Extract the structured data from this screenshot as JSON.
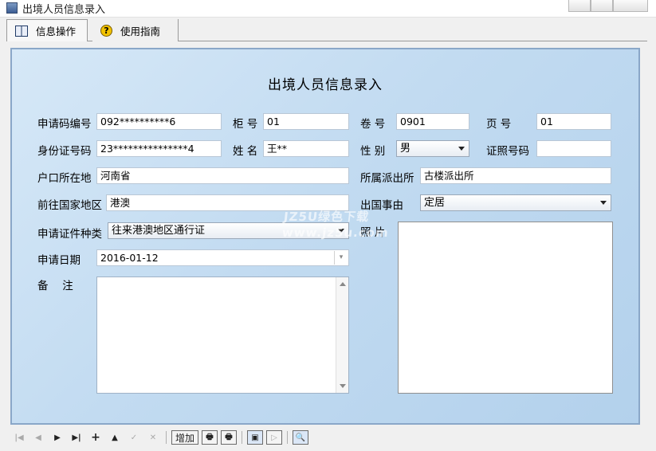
{
  "window": {
    "title": "出境人员信息录入"
  },
  "tabs": [
    {
      "label": "信息操作",
      "icon": "book-icon"
    },
    {
      "label": "使用指南",
      "icon": "help-icon"
    }
  ],
  "form": {
    "title": "出境人员信息录入",
    "apply_no": {
      "label": "申请码编号",
      "value": "092**********6"
    },
    "cabinet_no": {
      "label": "柜 号",
      "value": "01"
    },
    "volume_no": {
      "label": "卷 号",
      "value": "0901"
    },
    "page_no": {
      "label": "页 号",
      "value": "01"
    },
    "id_no": {
      "label": "身份证号码",
      "value": "23***************4"
    },
    "name": {
      "label": "姓 名",
      "value": "王**"
    },
    "gender": {
      "label": "性 别",
      "value": "男"
    },
    "cert_no": {
      "label": "证照号码",
      "value": ""
    },
    "household": {
      "label": "户口所在地",
      "value": "河南省"
    },
    "police_station": {
      "label": "所属派出所",
      "value": "古楼派出所"
    },
    "destination": {
      "label": "前往国家地区",
      "value": "港澳"
    },
    "exit_reason": {
      "label": "出国事由",
      "value": "定居"
    },
    "cert_type": {
      "label": "申请证件种类",
      "value": "往来港澳地区通行证"
    },
    "photo": {
      "label": "照 片"
    },
    "apply_date": {
      "label": "申请日期",
      "value": "2016-01-12"
    },
    "remarks": {
      "label": "备　 注",
      "value": ""
    }
  },
  "watermark": {
    "line1": "JZ5U绿色下载",
    "line2": "www.jz5u.com"
  },
  "navbar": {
    "first": "|◀",
    "prev": "◀",
    "next": "▶",
    "last": "▶|",
    "add_icon": "+",
    "up_icon": "▲",
    "check_icon": "✓",
    "cancel_icon": "✕",
    "add_label": "增加",
    "print_icon": "🖶",
    "print2_icon": "🖶",
    "preview_icon": "▣",
    "next2_icon": "▷",
    "find_icon": "🔍"
  }
}
